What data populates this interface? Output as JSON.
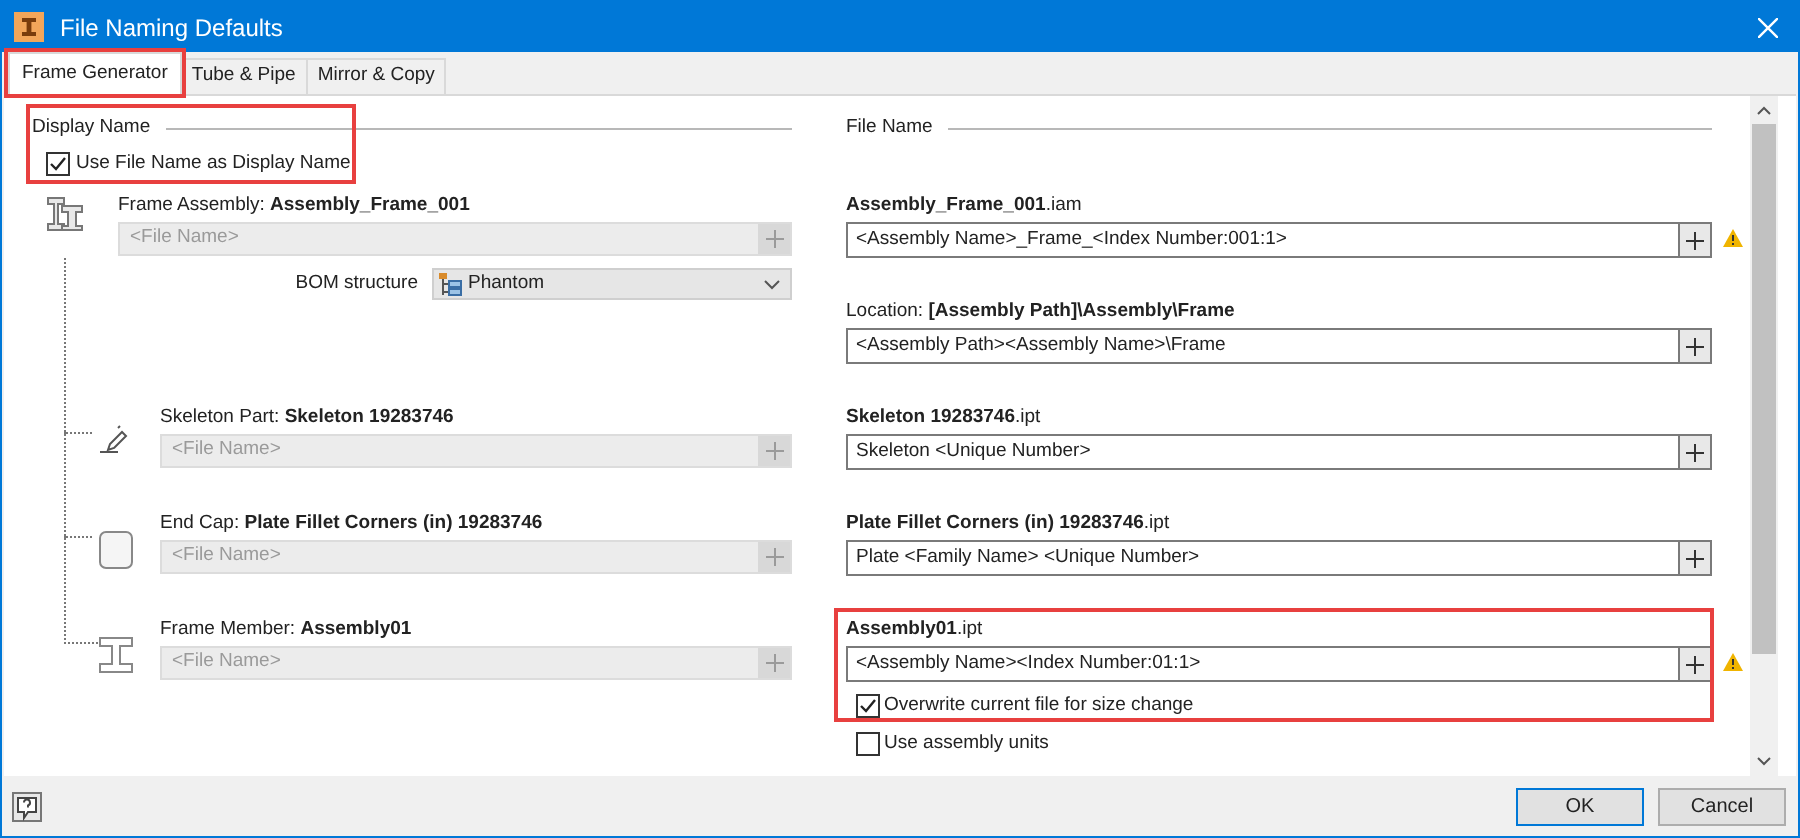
{
  "window": {
    "title": "File Naming Defaults"
  },
  "tabs": [
    {
      "label": "Frame Generator",
      "selected": true,
      "highlighted": true
    },
    {
      "label": "Tube & Pipe",
      "selected": false,
      "highlighted": false
    },
    {
      "label": "Mirror & Copy",
      "selected": false,
      "highlighted": false
    }
  ],
  "display_name": {
    "heading": "Display Name",
    "highlighted": true,
    "checkbox": {
      "label": "Use File Name as Display Name",
      "checked": true
    }
  },
  "components": [
    {
      "kind": "assembly",
      "label": "Frame Assembly: **Assembly_Frame_001**",
      "placeholder": "<File Name>",
      "disabled": true,
      "bom": {
        "label": "BOM structure",
        "value": "Phantom"
      }
    },
    {
      "kind": "skeleton",
      "label": "Skeleton Part: **Skeleton 19283746**",
      "placeholder": "<File Name>",
      "disabled": true
    },
    {
      "kind": "endcap",
      "label": "End Cap: **Plate Fillet Corners (in) 19283746**",
      "placeholder": "<File Name>",
      "disabled": true
    },
    {
      "kind": "member",
      "label": "Frame Member: **Assembly01**",
      "placeholder": "<File Name>",
      "disabled": true
    }
  ],
  "file_name": {
    "heading": "File Name",
    "entries": [
      {
        "label": "**Assembly_Frame_001**.iam",
        "value": "<Assembly Name>_Frame_<Index Number:001:1>",
        "warning": true,
        "highlighted": false
      },
      {
        "label": "Location: **[Assembly Path]\\Assembly\\Frame**",
        "value": "<Assembly Path><Assembly Name>\\Frame",
        "warning": false,
        "highlighted": false
      },
      {
        "label": "**Skeleton 19283746**.ipt",
        "value": "Skeleton <Unique Number>",
        "warning": false,
        "highlighted": false
      },
      {
        "label": "**Plate Fillet Corners (in) 19283746**.ipt",
        "value": "Plate <Family Name> <Unique Number>",
        "warning": false,
        "highlighted": false
      },
      {
        "label": "**Assembly01**.ipt",
        "value": "<Assembly Name><Index Number:01:1>",
        "warning": true,
        "highlighted": true,
        "options": [
          {
            "label": "Overwrite current file for size change",
            "checked": true
          }
        ]
      }
    ],
    "options": [
      {
        "label": "Use assembly units",
        "checked": false
      }
    ]
  },
  "buttons": [
    {
      "label": "OK",
      "default": true
    },
    {
      "label": "Cancel",
      "default": false
    }
  ]
}
